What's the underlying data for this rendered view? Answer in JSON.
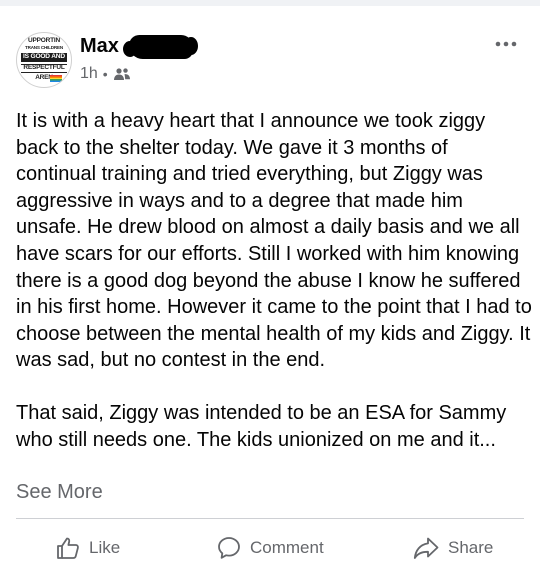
{
  "post": {
    "avatar": {
      "lines": [
        "UPPORTIN",
        "TRANS CHILDREN",
        "IS GOOD AND",
        "RESPECTFUL",
        "AREN"
      ]
    },
    "author_name": "Max",
    "time": "1h",
    "separator": "•",
    "audience_icon": "friends-icon",
    "body": [
      "It is with a heavy heart that I announce we took ziggy back to the shelter today.  We gave it 3 months of continual training and tried everything, but Ziggy was aggressive in ways and to a degree that made him unsafe.  He drew blood on almost a daily basis and we all have scars for our efforts.  Still I worked with him knowing there is a good dog beyond the abuse I know he suffered in his first home.  However it came to the point that I had to choose between the mental health of my kids and Ziggy.  It was sad, but no contest in the end.",
      "That said, Ziggy was intended to be an ESA for Sammy who still needs one.  The kids unionized on me and it..."
    ],
    "see_more": "See More"
  },
  "actions": {
    "like": "Like",
    "comment": "Comment",
    "share": "Share"
  },
  "colors": {
    "text": "#050505",
    "secondary": "#65676b",
    "divider": "#ced0d4"
  }
}
